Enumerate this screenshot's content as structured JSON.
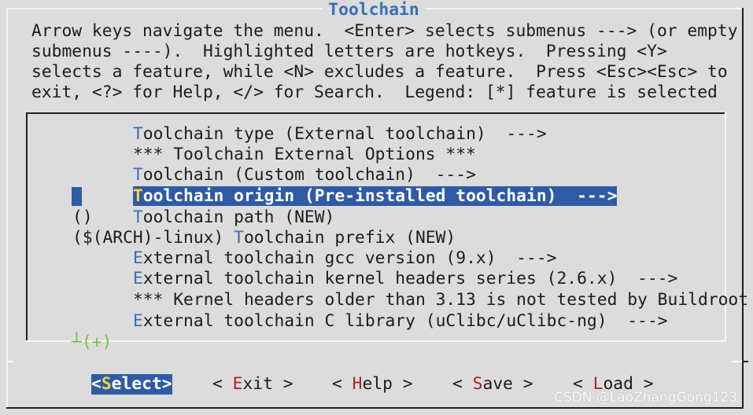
{
  "window": {
    "title": "Toolchain"
  },
  "help_lines": [
    "Arrow keys navigate the menu.  <Enter> selects submenus ---> (or empty",
    "submenus ----).  Highlighted letters are hotkeys.  Pressing <Y>",
    "selects a feature, while <N> excludes a feature.  Press <Esc><Esc> to",
    "exit, <?> for Help, </> for Search.  Legend: [*] feature is selected"
  ],
  "menu": {
    "items": [
      {
        "prefix": "      ",
        "hotkey": "T",
        "rest": "oolchain type (External toolchain)  --->"
      },
      {
        "prefix": "      ",
        "hotkey": "",
        "rest": "*** Toolchain External Options ***"
      },
      {
        "prefix": "      ",
        "hotkey": "T",
        "rest": "oolchain (Custom toolchain)  --->"
      },
      {
        "prefix": "      ",
        "hotkey": "T",
        "rest": "oolchain origin (Pre-installed toolchain)  --->",
        "selected": true
      },
      {
        "prefix": "()    ",
        "hotkey": "T",
        "rest": "oolchain path (NEW)"
      },
      {
        "prefix": "($(ARCH)-linux) ",
        "hotkey": "T",
        "rest": "oolchain prefix (NEW)"
      },
      {
        "prefix": "      ",
        "hotkey": "E",
        "rest": "xternal toolchain gcc version (9.x)  --->"
      },
      {
        "prefix": "      ",
        "hotkey": "E",
        "rest": "xternal toolchain kernel headers series (2.6.x)  --->"
      },
      {
        "prefix": "      ",
        "hotkey": "",
        "rest": "*** Kernel headers older than 3.13 is not tested by Buildroot"
      },
      {
        "prefix": "      ",
        "hotkey": "E",
        "rest": "xternal toolchain C library (uClibc/uClibc-ng)  --->"
      }
    ],
    "more_indicator": "┴(+)"
  },
  "buttons": {
    "select": {
      "pre": "<",
      "hot": "S",
      "post": "elect>"
    },
    "exit": {
      "pre": "< ",
      "hot": "E",
      "post": "xit >"
    },
    "help": {
      "pre": "< ",
      "hot": "H",
      "post": "elp >"
    },
    "save": {
      "pre": "< ",
      "hot": "S",
      "post": "ave >"
    },
    "load": {
      "pre": "< ",
      "hot": "L",
      "post": "oad >"
    }
  },
  "watermark": "CSDN @LaoZhangGong123",
  "colors": {
    "background": "#dcdcdc",
    "highlight": "#2f5aa6",
    "hotkey": "#3a6fb3",
    "hotkey_red": "#b02020",
    "hotkey_on_highlight": "#f3d33a"
  }
}
